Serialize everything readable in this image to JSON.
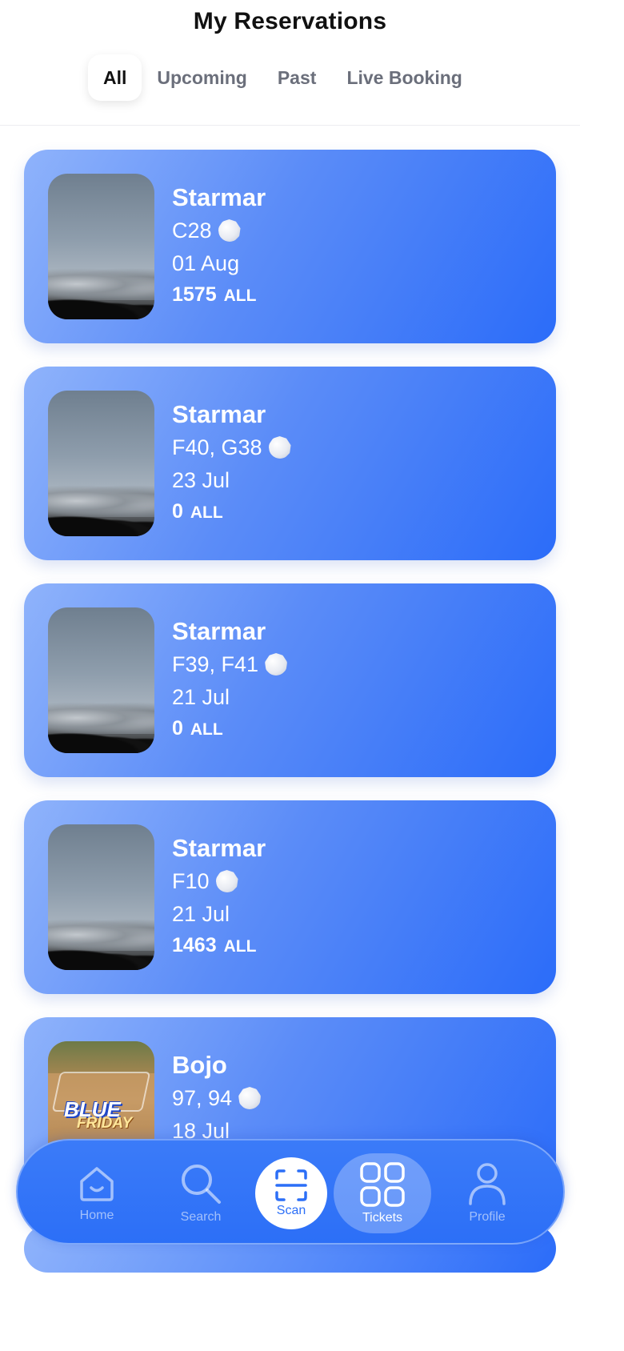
{
  "header": {
    "title": "My Reservations",
    "tabs": [
      {
        "label": "All",
        "active": true
      },
      {
        "label": "Upcoming",
        "active": false
      },
      {
        "label": "Past",
        "active": false
      },
      {
        "label": "Live Booking",
        "active": false
      }
    ]
  },
  "reservations": [
    {
      "venue": "Starmar",
      "seats": "C28",
      "date": "01 Aug",
      "price": "1575",
      "currency": "ALL",
      "image": "sky-photo"
    },
    {
      "venue": "Starmar",
      "seats": "F40, G38",
      "date": "23 Jul",
      "price": "0",
      "currency": "ALL",
      "image": "sky-photo"
    },
    {
      "venue": "Starmar",
      "seats": "F39, F41",
      "date": "21 Jul",
      "price": "0",
      "currency": "ALL",
      "image": "sky-photo"
    },
    {
      "venue": "Starmar",
      "seats": "F10",
      "date": "21 Jul",
      "price": "1463",
      "currency": "ALL",
      "image": "sky-photo"
    },
    {
      "venue": "Bojo",
      "seats": "97, 94",
      "date": "18 Jul",
      "price": "",
      "currency": "",
      "image": "blue-friday-poster",
      "poster_text_1": "BLUE",
      "poster_text_2": "FRIDAY"
    }
  ],
  "bottom_nav": {
    "items": [
      {
        "label": "Home",
        "icon": "home-icon"
      },
      {
        "label": "Search",
        "icon": "search-icon"
      },
      {
        "label": "Scan",
        "icon": "scan-icon"
      },
      {
        "label": "Tickets",
        "icon": "grid-icon",
        "active": true
      },
      {
        "label": "Profile",
        "icon": "profile-icon"
      }
    ]
  },
  "colors": {
    "card_gradient_start": "#8fb3fb",
    "card_gradient_end": "#2b6cf9",
    "nav_bg": "#2c6ff7",
    "active_tab_text": "#111111",
    "inactive_tab_text": "#6b6f7b"
  }
}
